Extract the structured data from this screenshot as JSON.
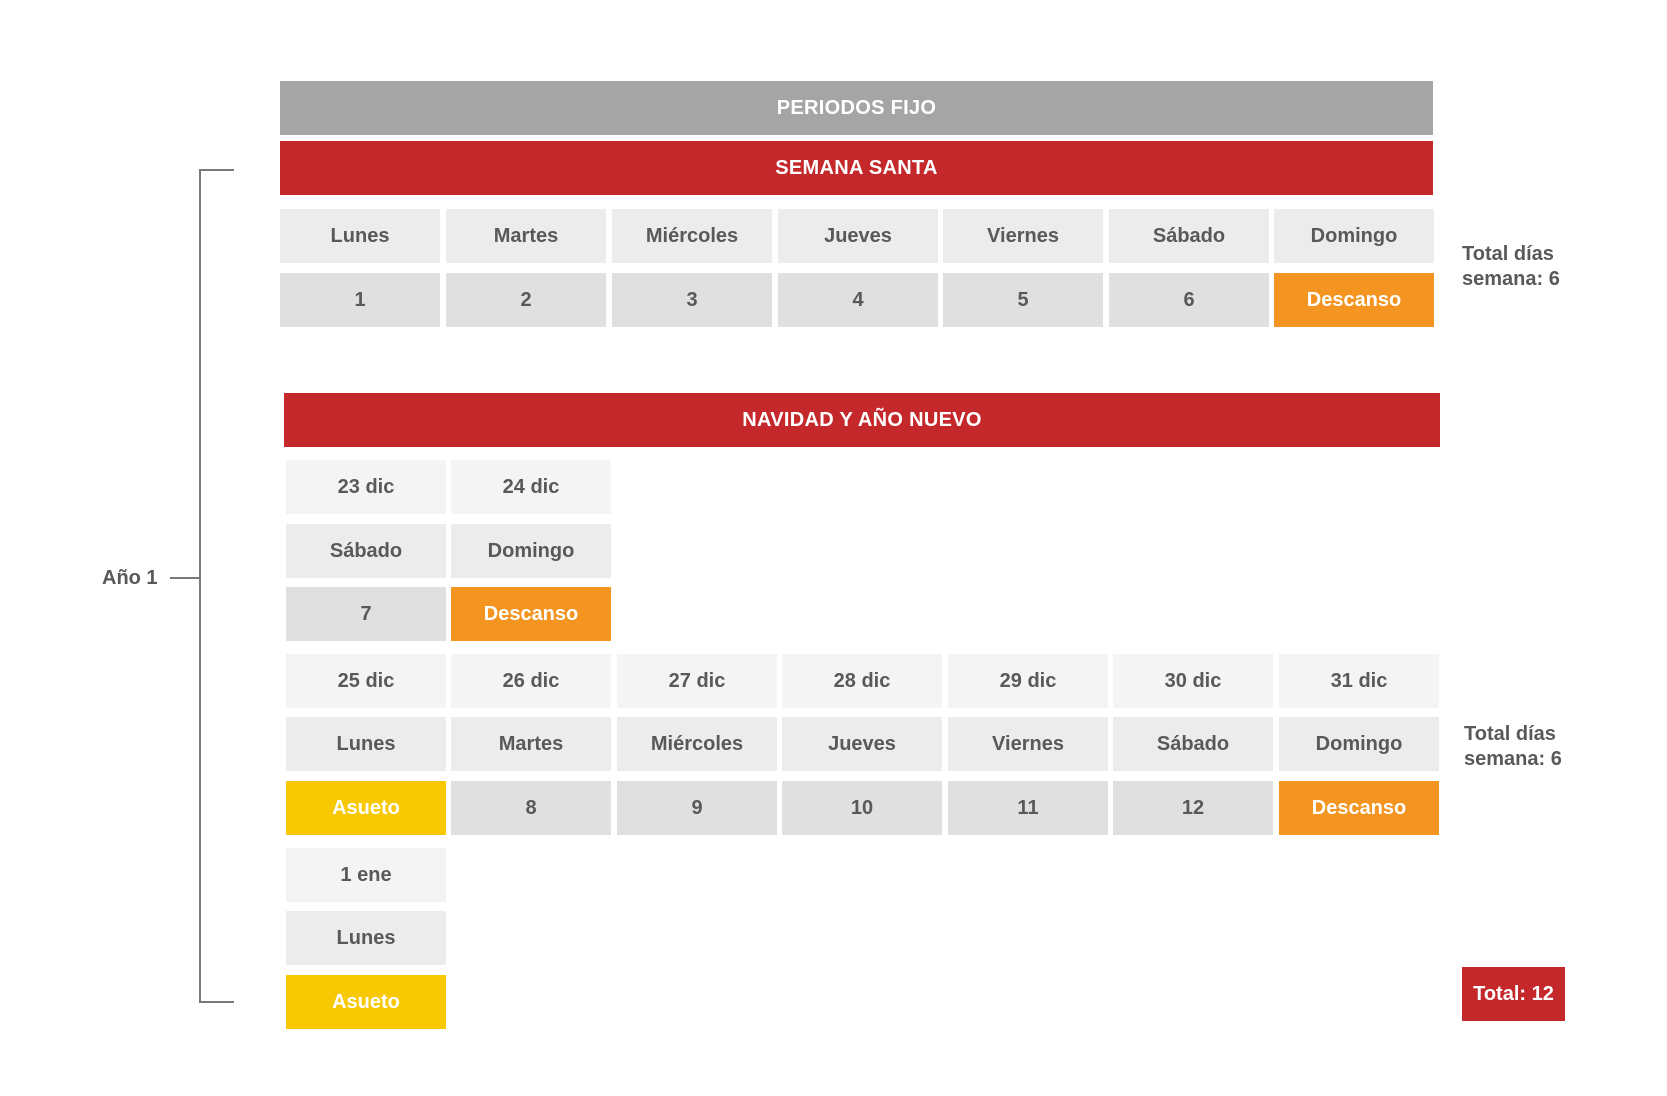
{
  "header": {
    "title": "PERIODOS FIJO"
  },
  "year_label": "Año 1",
  "semana_santa": {
    "title": "SEMANA SANTA",
    "days": [
      "Lunes",
      "Martes",
      "Miércoles",
      "Jueves",
      "Viernes",
      "Sábado",
      "Domingo"
    ],
    "values": [
      "1",
      "2",
      "3",
      "4",
      "5",
      "6",
      "Descanso"
    ],
    "total_line1": "Total días",
    "total_line2": "semana: 6"
  },
  "navidad": {
    "title": "NAVIDAD Y AÑO NUEVO",
    "block1": {
      "dates": [
        "23 dic",
        "24 dic"
      ],
      "days": [
        "Sábado",
        "Domingo"
      ],
      "values": [
        "7",
        "Descanso"
      ]
    },
    "block2": {
      "dates": [
        "25 dic",
        "26 dic",
        "27 dic",
        "28 dic",
        "29 dic",
        "30 dic",
        "31 dic"
      ],
      "days": [
        "Lunes",
        "Martes",
        "Miércoles",
        "Jueves",
        "Viernes",
        "Sábado",
        "Domingo"
      ],
      "values": [
        "Asueto",
        "8",
        "9",
        "10",
        "11",
        "12",
        "Descanso"
      ],
      "total_line1": "Total días",
      "total_line2": "semana: 6"
    },
    "block3": {
      "dates": [
        "1 ene"
      ],
      "days": [
        "Lunes"
      ],
      "values": [
        "Asueto"
      ]
    }
  },
  "total": "Total: 12",
  "colors": {
    "header_gray": "#a5a5a5",
    "section_red": "#c4282a",
    "rest_orange": "#f49522",
    "holiday_yellow": "#f8c803",
    "text_gray": "#595959"
  }
}
